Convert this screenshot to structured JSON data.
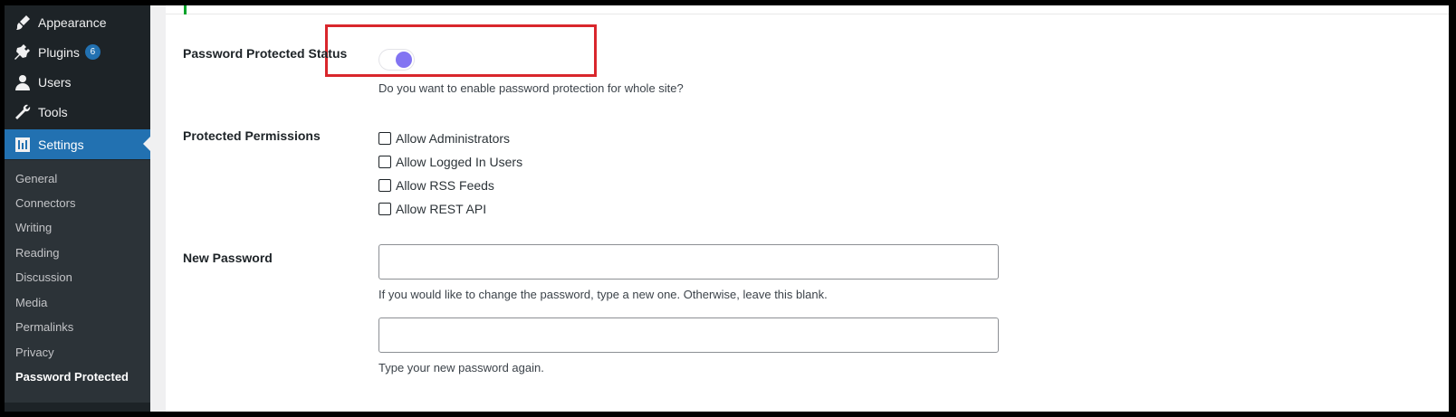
{
  "sidebar": {
    "menu": [
      {
        "label": "Appearance",
        "icon": "paintbrush-icon"
      },
      {
        "label": "Plugins",
        "icon": "plug-icon",
        "badge": "6"
      },
      {
        "label": "Users",
        "icon": "user-icon"
      },
      {
        "label": "Tools",
        "icon": "wrench-icon"
      },
      {
        "label": "Settings",
        "icon": "sliders-icon",
        "active": true
      }
    ],
    "submenu": [
      "General",
      "Connectors",
      "Writing",
      "Reading",
      "Discussion",
      "Media",
      "Permalinks",
      "Privacy",
      "Password Protected"
    ],
    "current_submenu": "Password Protected"
  },
  "settings": {
    "status": {
      "label": "Password Protected Status",
      "enabled": true,
      "description": "Do you want to enable password protection for whole site?"
    },
    "permissions": {
      "label": "Protected Permissions",
      "options": [
        "Allow Administrators",
        "Allow Logged In Users",
        "Allow RSS Feeds",
        "Allow REST API"
      ]
    },
    "password": {
      "label": "New Password",
      "value": "",
      "description": "If you would like to change the password, type a new one. Otherwise, leave this blank.",
      "confirm_value": "",
      "confirm_description": "Type your new password again."
    }
  },
  "colors": {
    "sidebar_bg": "#1d2327",
    "active": "#2271b1",
    "toggle_knob": "#8274f2",
    "highlight": "#d9262c"
  }
}
